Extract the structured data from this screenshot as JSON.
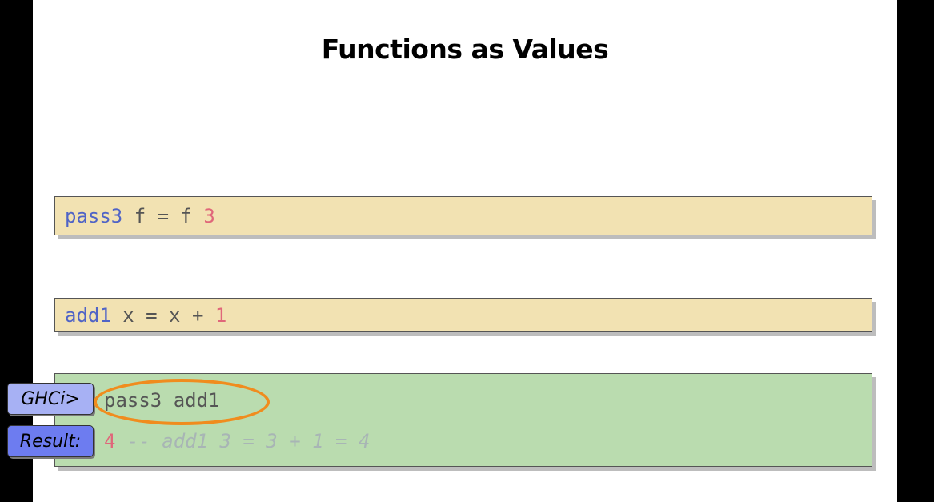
{
  "slide": {
    "title": "Functions as Values"
  },
  "code_block_1": {
    "fn_name": "pass3",
    "middle": " f = f ",
    "number": "3"
  },
  "code_block_2": {
    "fn_name": "add1",
    "middle": " x = x + ",
    "number": "1"
  },
  "ghci": {
    "prompt_label": "GHCi>",
    "command": "pass3 add1",
    "result_label": "Result:",
    "result_value": "4",
    "result_comment": " -- add1 3 = 3 + 1 = 4"
  },
  "colors": {
    "code_background": "#f2e2b2",
    "ghci_background": "#badcaf",
    "function_name": "#5064c6",
    "number": "#e0677a",
    "highlight": "#f08c1e"
  }
}
